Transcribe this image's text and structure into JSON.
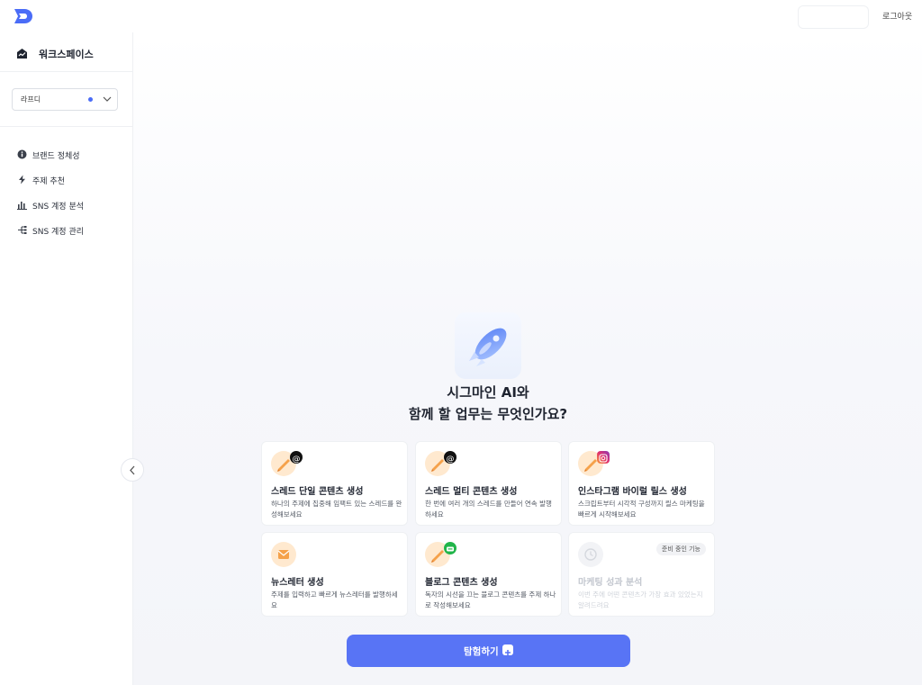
{
  "header": {
    "logout_label": "로그아웃",
    "logo_icon": "logo-icon"
  },
  "sidebar": {
    "workspace_title": "워크스페이스",
    "workspace_icon": "workspace-icon",
    "select_value": "라프디",
    "menu": [
      {
        "label": "브랜드 정체성",
        "icon": "info-circle-icon"
      },
      {
        "label": "주제 추천",
        "icon": "bolt-icon"
      },
      {
        "label": "SNS 계정 분석",
        "icon": "bar-chart-icon"
      },
      {
        "label": "SNS 계정 관리",
        "icon": "sitemap-icon"
      }
    ]
  },
  "main": {
    "headline_line1": "시그마인 AI와",
    "headline_line2": "함께 할 업무는 무엇인가요?",
    "cards": [
      {
        "title": "스레드 단일 콘텐츠 생성",
        "desc": "하나의 주제에 집중해 임팩트 있는 스레드를 완성해보세요",
        "icon": "pen-icon",
        "badge": "threads-icon"
      },
      {
        "title": "스레드 멀티 콘텐츠 생성",
        "desc": "한 번에 여러 개의 스레드를 만들어 연속 발행하세요",
        "icon": "pen-icon",
        "badge": "threads-icon"
      },
      {
        "title": "인스타그램 바이럴 릴스 생성",
        "desc": "스크립트부터 시각적 구성까지 릴스 마케팅을 빠르게 시작해보세요",
        "icon": "pen-icon",
        "badge": "instagram-icon"
      },
      {
        "title": "뉴스레터 생성",
        "desc": "주제를 입력하고 빠르게 뉴스레터를 발행하세요",
        "icon": "envelope-icon"
      },
      {
        "title": "블로그 콘텐츠 생성",
        "desc": "독자의 시선을 끄는 블로그 콘텐츠를 주제 하나로 작성해보세요",
        "icon": "pen-icon",
        "badge": "naver-blog-icon"
      },
      {
        "title": "마케팅 성과 분석",
        "desc": "이번 주에 어떤 콘텐츠가 가장 효과 있었는지 알려드려요",
        "icon": "clock-icon",
        "status": "준비 중인 기능"
      }
    ],
    "explore_label": "탐험하기"
  },
  "colors": {
    "accent": "#5874f5",
    "select_dot": "#4a6cf7"
  }
}
